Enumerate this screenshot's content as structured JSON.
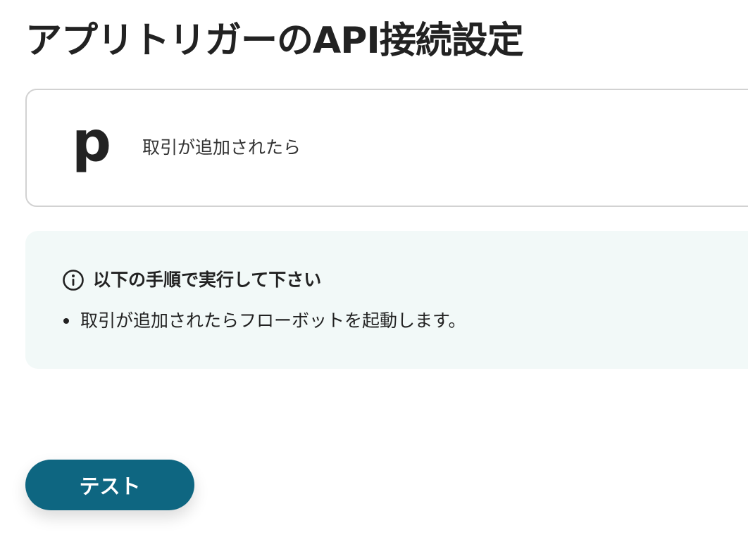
{
  "page": {
    "title": "アプリトリガーのAPI接続設定"
  },
  "trigger_card": {
    "app_logo_letter": "p",
    "label": "取引が追加されたら"
  },
  "info_box": {
    "icon": "info-circle-icon",
    "title": "以下の手順で実行して下さい",
    "items": [
      "取引が追加されたらフローボットを起動します。"
    ],
    "background_color": "#f2f9f8"
  },
  "actions": {
    "test_label": "テスト",
    "button_color": "#0e6681"
  }
}
